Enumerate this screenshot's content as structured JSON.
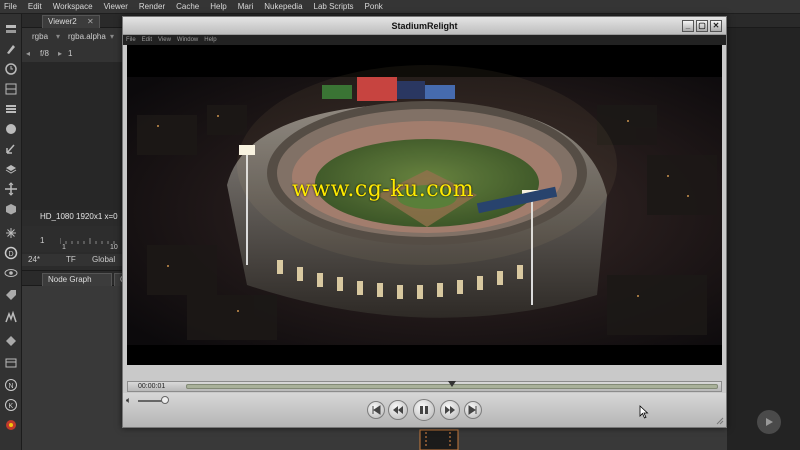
{
  "menubar": {
    "items": [
      "File",
      "Edit",
      "Workspace",
      "Viewer",
      "Render",
      "Cache",
      "Help",
      "Mari",
      "Nukepedia",
      "Lab Scripts",
      "Ponk"
    ]
  },
  "viewer_pane": {
    "tab": "Viewer2",
    "channels": "rgba",
    "alpha": "rgba.alpha",
    "fstop": "f/8",
    "frame": "1",
    "format": "HD_1080 1920x1 x=0",
    "timeline_start": "1",
    "timeline_end": "10",
    "fps": "24*",
    "tf": "TF",
    "global": "Global"
  },
  "node_graph": {
    "tab": "Node Graph",
    "tab2": "C"
  },
  "player": {
    "title": "StadiumRelight",
    "menu": [
      "File",
      "Edit",
      "View",
      "Window",
      "Help"
    ],
    "watermark": "www.cg-ku.com",
    "timecode": "00:00:01",
    "progress_fraction": 0.5
  },
  "colors": {
    "accent_yellow": "#ffea00",
    "nuke_bg": "#2b2b2b",
    "player_chrome": "#c9c9c9"
  }
}
